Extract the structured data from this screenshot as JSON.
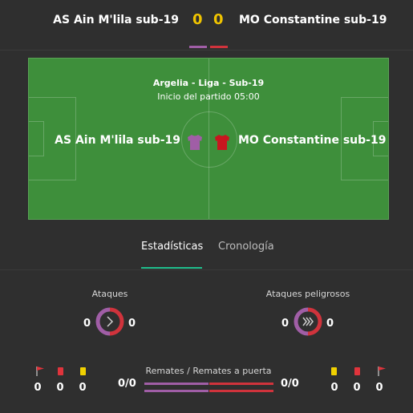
{
  "header": {
    "home_team": "AS Ain M'lila sub-19",
    "away_team": "MO Constantine sub-19",
    "home_score": "0",
    "away_score": "0",
    "home_color": "#a05ea6",
    "away_color": "#d0333c"
  },
  "pitch": {
    "league": "Argelia - Liga - Sub-19",
    "kickoff": "Inicio del partido  05:00",
    "home_team": "AS Ain M'lila sub-19",
    "away_team": "MO Constantine sub-19",
    "home_shirt_icon": "shirt-icon",
    "away_shirt_icon": "shirt-icon"
  },
  "tabs": [
    {
      "label": "Estadísticas",
      "active": true
    },
    {
      "label": "Cronología",
      "active": false
    }
  ],
  "stats": {
    "attacks": {
      "label": "Ataques",
      "home": "0",
      "away": "0",
      "icon": "chevron-right-icon"
    },
    "dangerous_attacks": {
      "label": "Ataques peligrosos",
      "home": "0",
      "away": "0",
      "icon": "double-chevron-right-icon"
    },
    "shots": {
      "label": "Remates / Remates a puerta",
      "home": "0/0",
      "away": "0/0"
    },
    "home_cards": {
      "corners": "0",
      "red_cards": "0",
      "yellow_cards": "0"
    },
    "away_cards": {
      "yellow_cards": "0",
      "red_cards": "0",
      "corners": "0"
    }
  }
}
